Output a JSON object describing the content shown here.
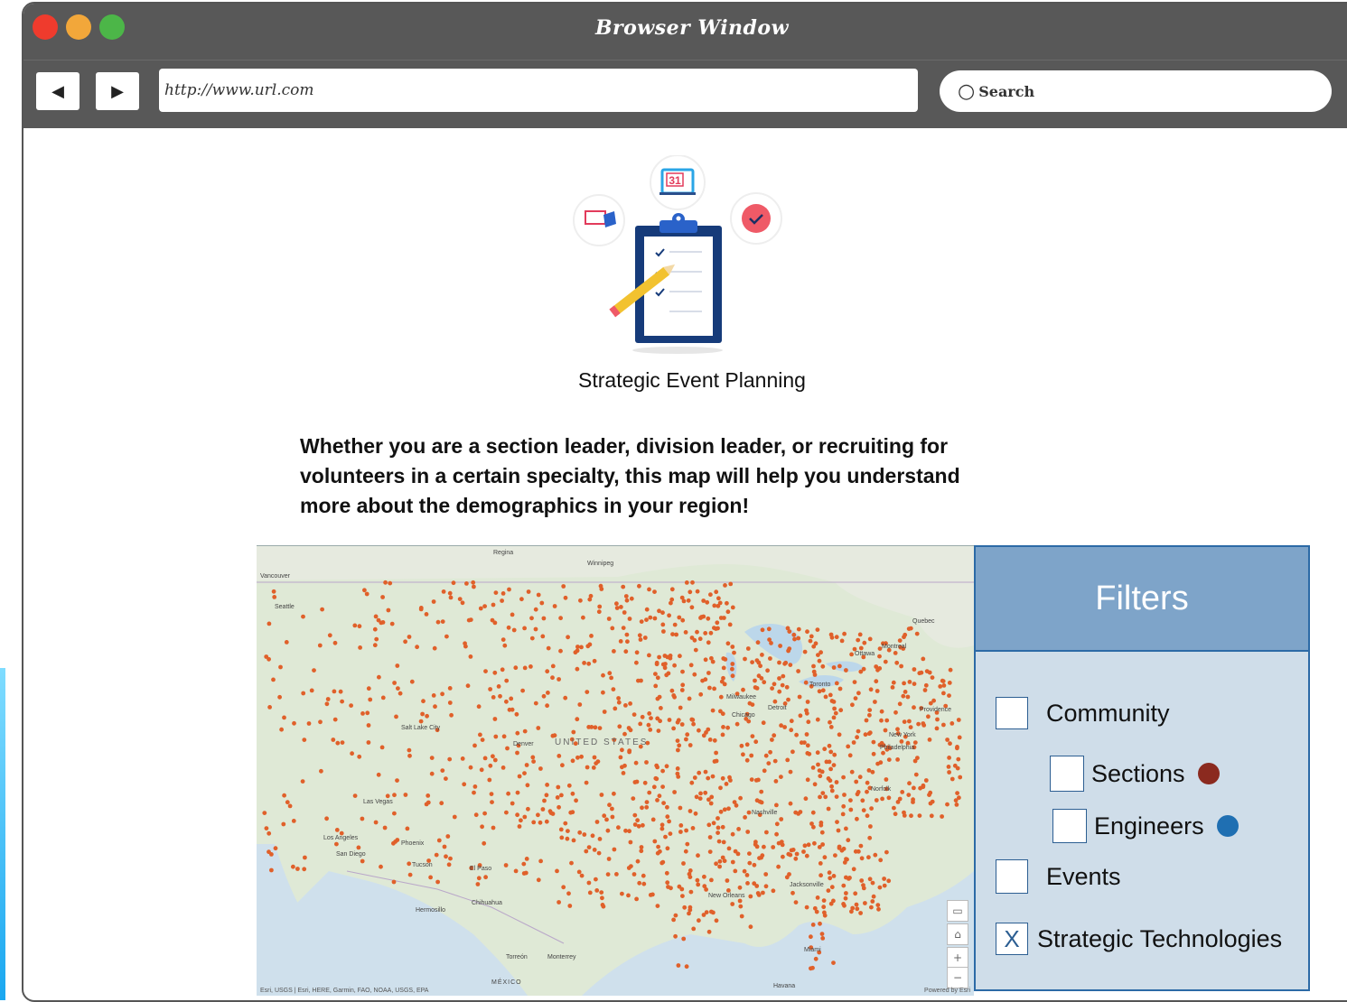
{
  "browser": {
    "title": "Browser Window",
    "url": "http://www.url.com",
    "search_placeholder": "Search",
    "back_glyph": "◀",
    "forward_glyph": "▶",
    "search_glyph": "○"
  },
  "hero": {
    "calendar_day": "31",
    "icon": "clipboard-checklist-icon"
  },
  "page": {
    "title": "Strategic Event Planning",
    "intro_line1": "Whether you are a section leader, division leader, or recruiting for",
    "intro_line2": "volunteers in a certain specialty, this map will help you understand",
    "intro_line3": "more about the demographics in your region!"
  },
  "map": {
    "labels": {
      "regina": "Regina",
      "winnipeg": "Winnipeg",
      "vancouver": "Vancouver",
      "seattle": "Seattle",
      "quebec": "Quebec",
      "ottawa": "Ottawa",
      "montreal": "Montreal",
      "toronto": "Toronto",
      "chicago": "Chicago",
      "detroit": "Detroit",
      "milwaukee": "Milwaukee",
      "new_york": "New York",
      "philadelphia": "Philadelphia",
      "providence": "Providence",
      "salt_lake_city": "Salt Lake City",
      "denver": "Denver",
      "united_states": "UNITED STATES",
      "las_vegas": "Las Vegas",
      "los_angeles": "Los Angeles",
      "san_diego": "San Diego",
      "phoenix": "Phoenix",
      "tucson": "Tucson",
      "el_paso": "El Paso",
      "hermosillo": "Hermosillo",
      "chihuahua": "Chihuahua",
      "monterrey": "Monterrey",
      "torreon": "Torreón",
      "mexico": "MÉXICO",
      "new_orleans": "New Orleans",
      "jacksonville": "Jacksonville",
      "miami": "Miami",
      "havana": "Havana",
      "nashville": "Nashville",
      "norfolk": "Norfolk"
    },
    "attribution": "Esri, USGS | Esri, HERE, Garmin, FAO, NOAA, USGS, EPA",
    "powered_by": "Powered by Esri",
    "controls": {
      "display_glyph": "▭",
      "home_glyph": "⌂",
      "zoom_in_glyph": "+",
      "zoom_out_glyph": "−"
    },
    "marker_color": "#e0602a"
  },
  "filters": {
    "title": "Filters",
    "items": [
      {
        "label": "Community",
        "checked": false,
        "mark": ""
      },
      {
        "label": "Sections",
        "checked": false,
        "mark": "",
        "dot_color": "#8b2a1f"
      },
      {
        "label": "Engineers",
        "checked": false,
        "mark": "",
        "dot_color": "#1f6fb2"
      },
      {
        "label": "Events",
        "checked": false,
        "mark": ""
      },
      {
        "label": "Strategic Technologies",
        "checked": true,
        "mark": "X"
      }
    ]
  }
}
